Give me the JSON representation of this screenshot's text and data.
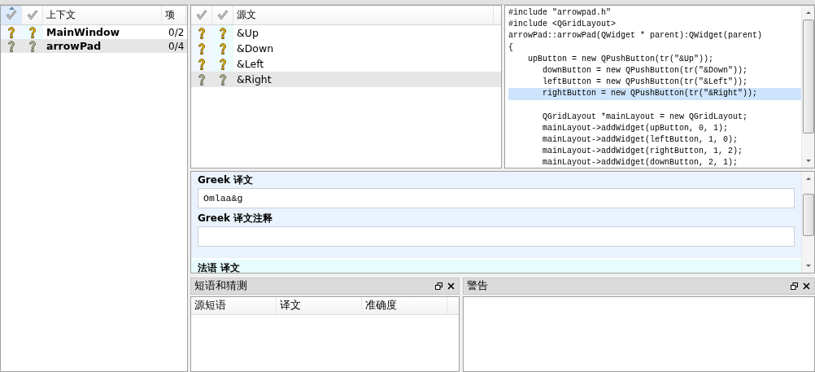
{
  "contexts": {
    "columns": [
      {
        "kind": "check",
        "sorted": true
      },
      {
        "kind": "check",
        "sorted": false
      },
      {
        "kind": "text",
        "label": "上下文"
      },
      {
        "kind": "text",
        "label": "项"
      }
    ],
    "rows": [
      {
        "name": "MainWindow",
        "count": "0/2",
        "selected": false
      },
      {
        "name": "arrowPad",
        "count": "0/4",
        "selected": true
      }
    ]
  },
  "messages": {
    "columns": [
      {
        "kind": "check"
      },
      {
        "kind": "check"
      },
      {
        "kind": "text",
        "label": "源文"
      }
    ],
    "rows": [
      {
        "source": "&Up",
        "selected": false
      },
      {
        "source": "&Down",
        "selected": false
      },
      {
        "source": "&Left",
        "selected": false
      },
      {
        "source": "&Right",
        "selected": true
      }
    ]
  },
  "code": {
    "lines": [
      {
        "text": "#include \"arrowpad.h\"",
        "highlighted": false
      },
      {
        "text": "#include <QGridLayout>",
        "highlighted": false
      },
      {
        "text": "arrowPad::arrowPad(QWidget * parent):QWidget(parent)",
        "highlighted": false
      },
      {
        "text": "{",
        "highlighted": false
      },
      {
        "text": "    upButton = new QPushButton(tr(\"&Up\"));",
        "highlighted": false
      },
      {
        "text": "       downButton = new QPushButton(tr(\"&Down\"));",
        "highlighted": false
      },
      {
        "text": "       leftButton = new QPushButton(tr(\"&Left\"));",
        "highlighted": false
      },
      {
        "text": "       rightButton = new QPushButton(tr(\"&Right\"));",
        "highlighted": true
      },
      {
        "text": "       QGridLayout *mainLayout = new QGridLayout;",
        "highlighted": false,
        "blank_line_before": true
      },
      {
        "text": "       mainLayout->addWidget(upButton, 0, 1);",
        "highlighted": false
      },
      {
        "text": "       mainLayout->addWidget(leftButton, 1, 0);",
        "highlighted": false
      },
      {
        "text": "       mainLayout->addWidget(rightButton, 1, 2);",
        "highlighted": false
      },
      {
        "text": "       mainLayout->addWidget(downButton, 2, 1);",
        "highlighted": false
      }
    ]
  },
  "translation": {
    "sections": [
      {
        "kind": "greek",
        "label": "Greek 译文",
        "value": "Omlaa&g"
      },
      {
        "kind": "greek",
        "label": "Greek 译文注释"
      },
      {
        "kind": "french",
        "label": "法语 译文"
      }
    ]
  },
  "docks": [
    {
      "title": "短语和猜测",
      "columns": [
        "源短语",
        "译文",
        "准确度"
      ]
    },
    {
      "title": "警告"
    }
  ]
}
